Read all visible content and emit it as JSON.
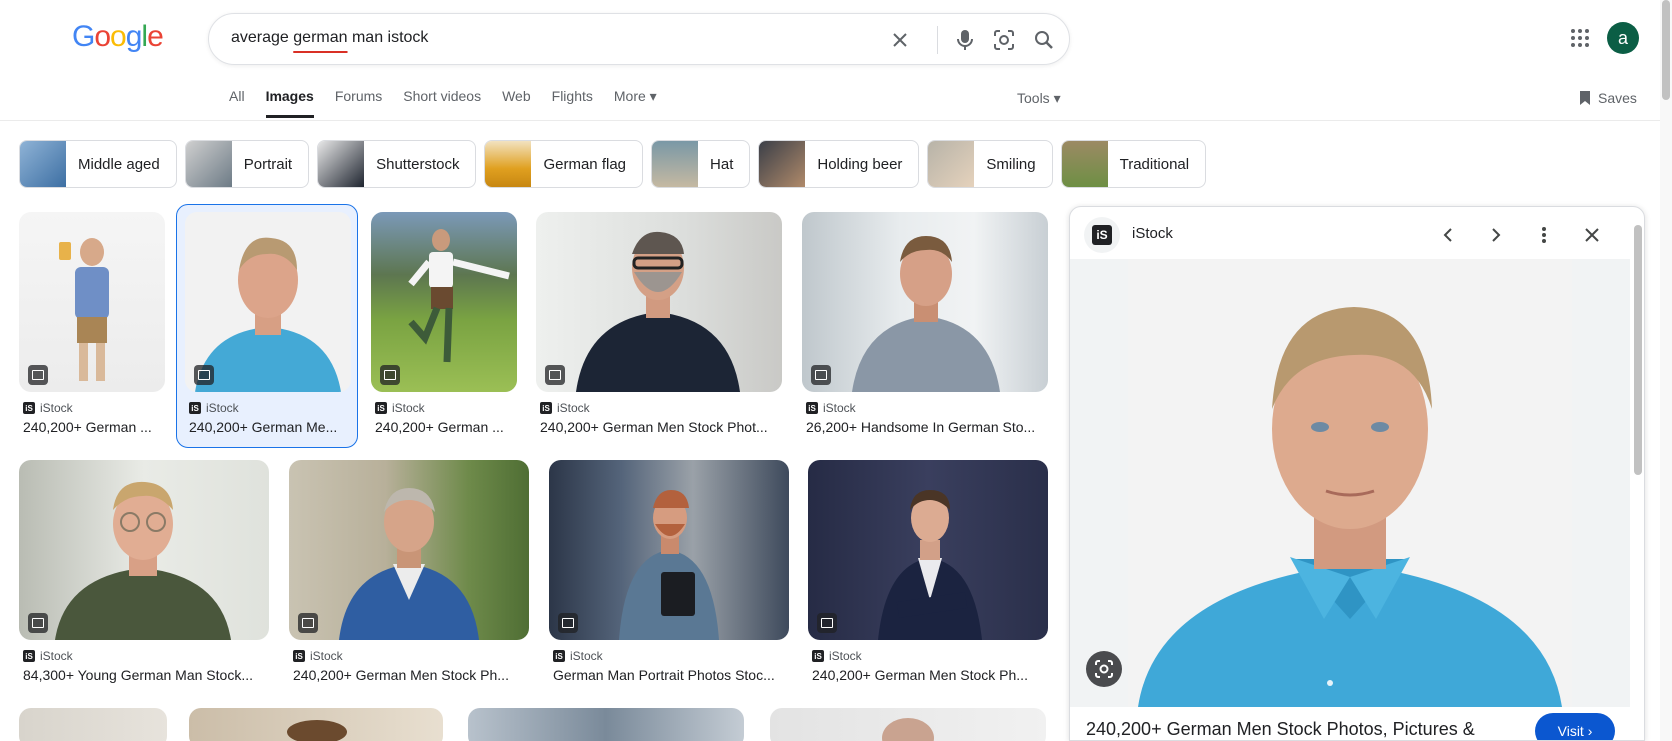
{
  "logo": "Google",
  "search": {
    "query_start": "average ",
    "query_underlined": "german",
    "query_end": " man istock"
  },
  "account": {
    "avatar_letter": "a"
  },
  "tabs": [
    "All",
    "Images",
    "Forums",
    "Short videos",
    "Web",
    "Flights",
    "More ▾"
  ],
  "active_tab": "Images",
  "tools_label": "Tools ▾",
  "saves_label": "Saves",
  "chips": [
    "Middle aged",
    "Portrait",
    "Shutterstock",
    "German flag",
    "Hat",
    "Holding beer",
    "Smiling",
    "Traditional"
  ],
  "results": [
    {
      "source": "iStock",
      "title": "240,200+ German ..."
    },
    {
      "source": "iStock",
      "title": "240,200+ German Me..."
    },
    {
      "source": "iStock",
      "title": "240,200+ German ..."
    },
    {
      "source": "iStock",
      "title": "240,200+ German Men Stock Phot..."
    },
    {
      "source": "iStock",
      "title": "26,200+ Handsome In German Sto..."
    },
    {
      "source": "iStock",
      "title": "84,300+ Young German Man Stock..."
    },
    {
      "source": "iStock",
      "title": "240,200+ German Men Stock Ph..."
    },
    {
      "source": "iStock",
      "title": "German Man Portrait Photos Stoc..."
    },
    {
      "source": "iStock",
      "title": "240,200+ German Men Stock Ph..."
    }
  ],
  "panel": {
    "source": "iStock",
    "title": "240,200+ German Men Stock Photos, Pictures &",
    "visit_label": "Visit ›"
  },
  "colors": {
    "accent_blue": "#1a73e8",
    "visit_button": "#0b57d0",
    "avatar": "#0b5e45"
  }
}
